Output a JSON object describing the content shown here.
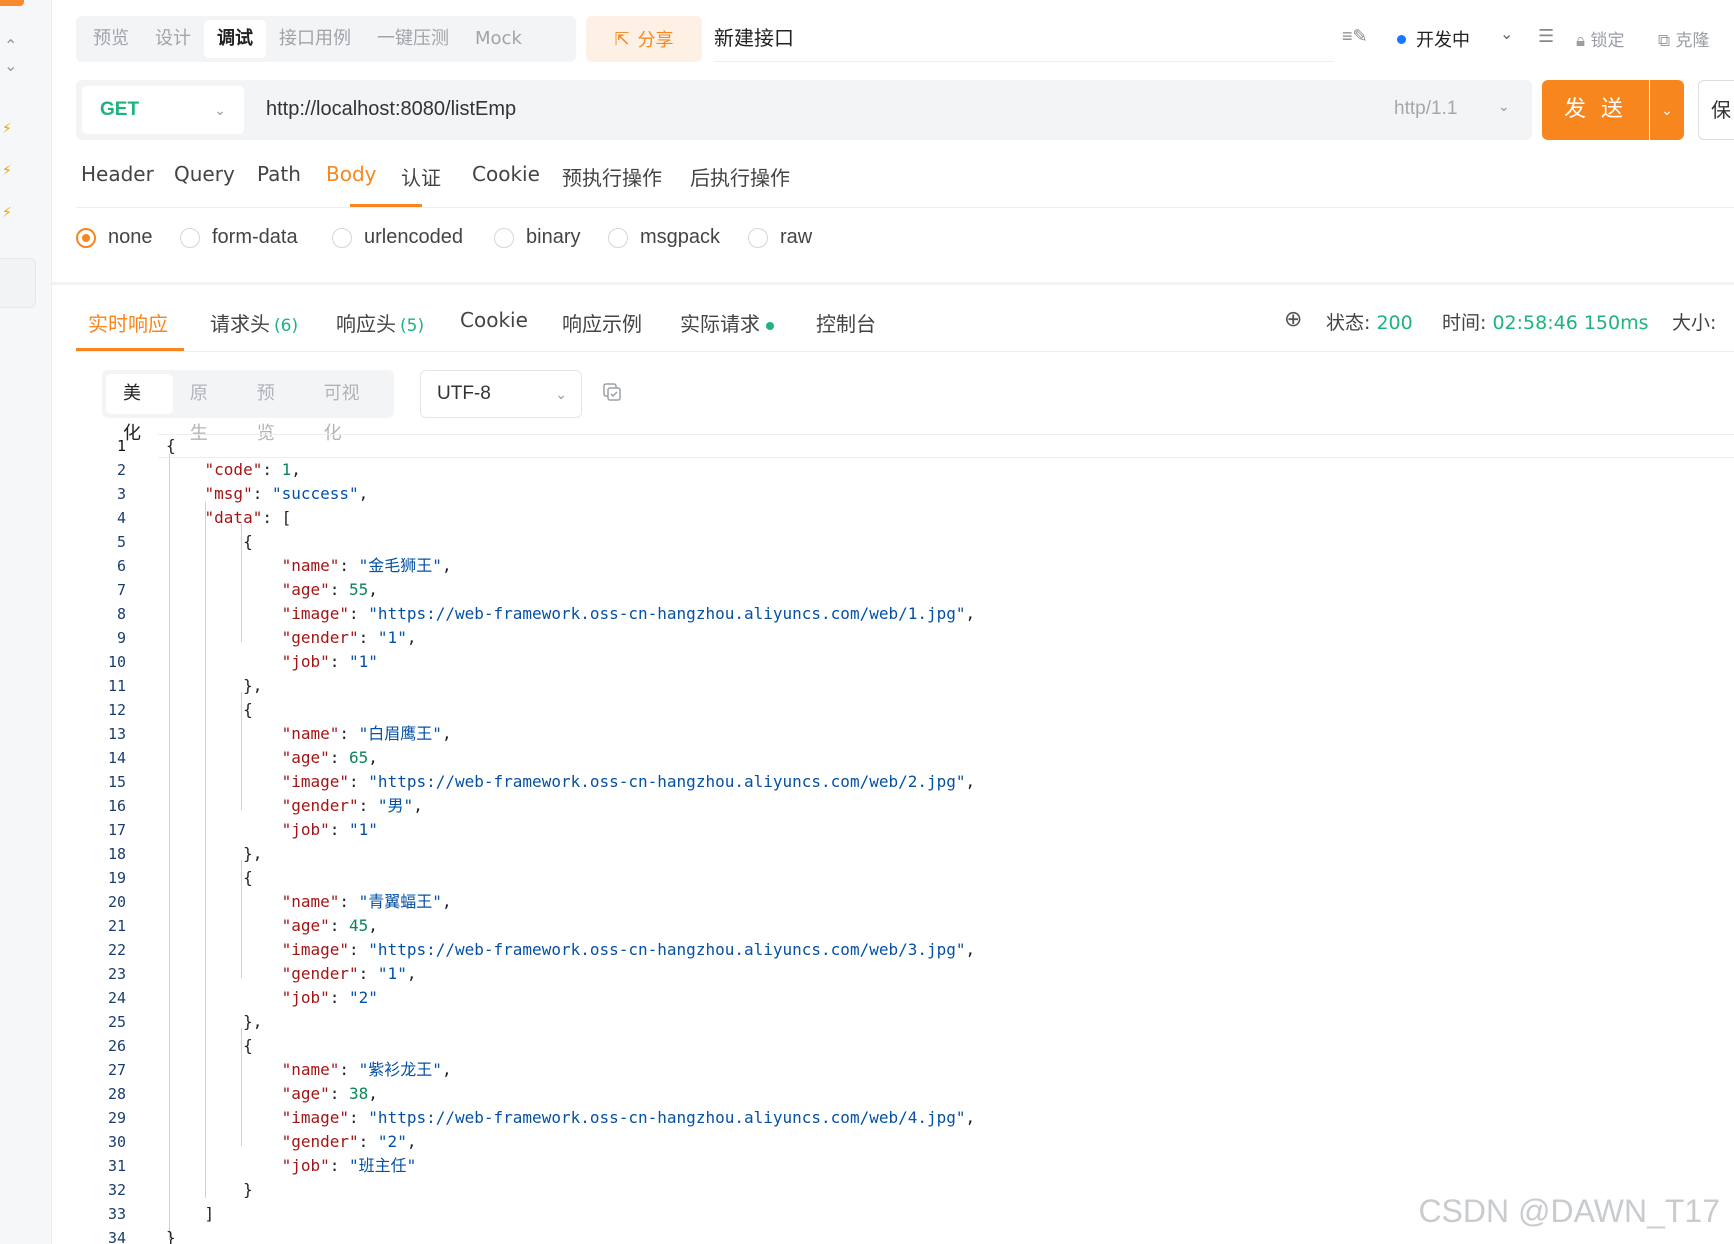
{
  "top": {
    "mode_tabs": [
      "预览",
      "设计",
      "调试",
      "接口用例",
      "一键压测",
      "Mock"
    ],
    "active_mode": "调试",
    "share_label": "分享",
    "api_name": "新建接口",
    "status": "开发中",
    "lock_label": "锁定",
    "clone_label": "克隆"
  },
  "request": {
    "method": "GET",
    "url": "http://localhost:8080/listEmp",
    "protocol": "http/1.1",
    "send_label": "发 送",
    "save_label_partial": "保"
  },
  "req_tabs": [
    "Header",
    "Query",
    "Path",
    "Body",
    "认证",
    "Cookie",
    "预执行操作",
    "后执行操作"
  ],
  "active_req_tab": "Body",
  "body_types": [
    "none",
    "form-data",
    "urlencoded",
    "binary",
    "msgpack",
    "raw"
  ],
  "selected_body_type": "none",
  "response": {
    "tabs": {
      "realtime": "实时响应",
      "req_headers": "请求头",
      "req_headers_count": "(6)",
      "resp_headers": "响应头",
      "resp_headers_count": "(5)",
      "cookie": "Cookie",
      "example": "响应示例",
      "actual": "实际请求",
      "console": "控制台"
    },
    "status_label": "状态:",
    "status_value": "200",
    "time_label": "时间:",
    "time_value": "02:58:46",
    "duration_value": "150ms",
    "size_label": "大小:"
  },
  "view_modes": [
    "美化",
    "原生",
    "预览",
    "可视化"
  ],
  "active_view_mode": "美化",
  "encoding": "UTF-8",
  "code_lines": [
    "{",
    "    \"code\": 1,",
    "    \"msg\": \"success\",",
    "    \"data\": [",
    "        {",
    "            \"name\": \"金毛狮王\",",
    "            \"age\": 55,",
    "            \"image\": \"https://web-framework.oss-cn-hangzhou.aliyuncs.com/web/1.jpg\",",
    "            \"gender\": \"1\",",
    "            \"job\": \"1\"",
    "        },",
    "        {",
    "            \"name\": \"白眉鹰王\",",
    "            \"age\": 65,",
    "            \"image\": \"https://web-framework.oss-cn-hangzhou.aliyuncs.com/web/2.jpg\",",
    "            \"gender\": \"男\",",
    "            \"job\": \"1\"",
    "        },",
    "        {",
    "            \"name\": \"青翼蝠王\",",
    "            \"age\": 45,",
    "            \"image\": \"https://web-framework.oss-cn-hangzhou.aliyuncs.com/web/3.jpg\",",
    "            \"gender\": \"1\",",
    "            \"job\": \"2\"",
    "        },",
    "        {",
    "            \"name\": \"紫衫龙王\",",
    "            \"age\": 38,",
    "            \"image\": \"https://web-framework.oss-cn-hangzhou.aliyuncs.com/web/4.jpg\",",
    "            \"gender\": \"2\",",
    "            \"job\": \"班主任\"",
    "        }",
    "    ]",
    "}"
  ],
  "watermark": "CSDN @DAWN_T17",
  "colors": {
    "accent": "#f7861f",
    "success": "#1fb37b",
    "json_key": "#a31515",
    "json_string": "#0451a5",
    "json_number": "#098658"
  }
}
